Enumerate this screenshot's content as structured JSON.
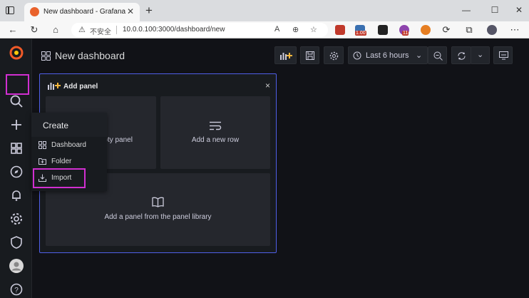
{
  "browser": {
    "tab_title": "New dashboard - Grafana",
    "tab_close": "✕",
    "new_tab": "+",
    "window_minimize": "—",
    "window_maximize": "☐",
    "window_close": "✕",
    "security_label": "不安全",
    "url": "10.0.0.100:3000/dashboard/new",
    "extension_badge_1": "1.00",
    "extension_badge_2": "11"
  },
  "grafana": {
    "dashboard_title": "New dashboard",
    "time_range": "Last 6 hours",
    "add_panel": {
      "title": "Add panel",
      "close": "×",
      "tiles": {
        "empty_panel": "Add an empty panel",
        "empty_panel_visible": "pty panel",
        "new_row": "Add a new row",
        "library": "Add a panel from the panel library"
      }
    },
    "create_menu": {
      "title": "Create",
      "items": [
        {
          "label": "Dashboard",
          "icon": "apps-icon"
        },
        {
          "label": "Folder",
          "icon": "folder-plus-icon"
        },
        {
          "label": "Import",
          "icon": "import-icon"
        }
      ]
    }
  },
  "colors": {
    "highlight": "#d12fd1",
    "panel_border": "#4f5fe8",
    "grafana_logo": "#f05a28"
  }
}
